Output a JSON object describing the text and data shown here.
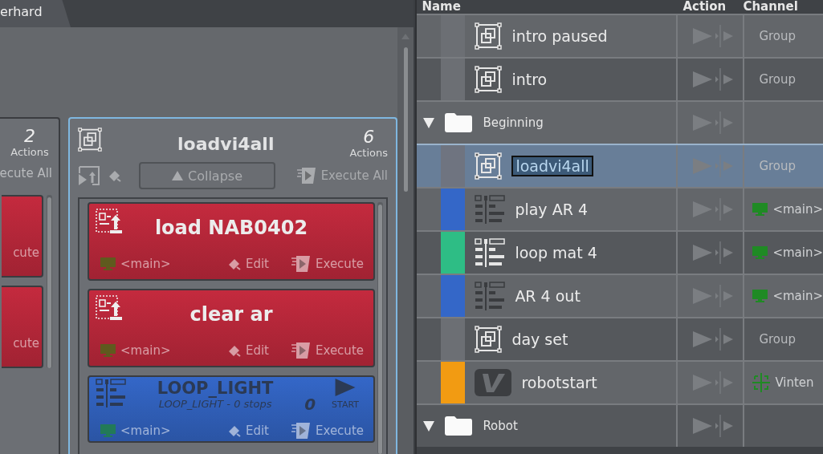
{
  "tab": {
    "label": "erhard"
  },
  "left_group": {
    "count": "2",
    "count_label": "Actions",
    "execute_all": "ecute All",
    "actions": [
      {
        "execute": "cute",
        "color": "#c42a3e"
      },
      {
        "execute": "cute",
        "color": "#c42a3e"
      }
    ]
  },
  "group": {
    "title": "loadvi4all",
    "count": "6",
    "count_label": "Actions",
    "collapse": "Collapse",
    "execute_all": "Execute All",
    "selected": true,
    "actions": [
      {
        "kind": "load",
        "title": "load NAB0402",
        "channel": "<main>",
        "edit": "Edit",
        "execute": "Execute",
        "color": "#c42a3e"
      },
      {
        "kind": "load",
        "title": "clear ar",
        "channel": "<main>",
        "edit": "Edit",
        "execute": "Execute",
        "color": "#c42a3e"
      },
      {
        "kind": "playlist",
        "title": "LOOP_LIGHT",
        "subtitle": "LOOP_LIGHT - 0 stops",
        "counter": "0",
        "start": "START",
        "channel": "<main>",
        "edit": "Edit",
        "execute": "Execute",
        "color": "#3467c8"
      }
    ]
  },
  "table": {
    "columns": [
      "Name",
      "Action",
      "Channel"
    ],
    "rows": [
      {
        "kind": "group",
        "name": "intro paused",
        "color": "#6c6f74",
        "selected": false,
        "channel": {
          "kind": "text",
          "label": "Group"
        }
      },
      {
        "kind": "group",
        "name": "intro",
        "color": "#6c6f74",
        "selected": false,
        "channel": {
          "kind": "text",
          "label": "Group"
        }
      },
      {
        "kind": "folder",
        "name": "Beginning",
        "expanded": true,
        "selected": false
      },
      {
        "kind": "group",
        "name": "loadvi4all",
        "color": "#6f7480",
        "selected": true,
        "channel": {
          "kind": "text",
          "label": "Group"
        }
      },
      {
        "kind": "playlist",
        "name": "play AR 4",
        "color": "#3467c8",
        "selected": false,
        "channel": {
          "kind": "screen",
          "label": "<main>"
        }
      },
      {
        "kind": "playlist",
        "name": "loop mat 4",
        "color": "#2ebd85",
        "selected": false,
        "channel": {
          "kind": "screen",
          "label": "<main>"
        }
      },
      {
        "kind": "playlist",
        "name": "AR 4 out",
        "color": "#3467c8",
        "selected": false,
        "channel": {
          "kind": "screen",
          "label": "<main>"
        }
      },
      {
        "kind": "group",
        "name": "day set",
        "color": "#6c6f74",
        "selected": false,
        "channel": {
          "kind": "text",
          "label": "Group"
        }
      },
      {
        "kind": "robot",
        "name": "robotstart",
        "color": "#f29b12",
        "selected": false,
        "channel": {
          "kind": "vinten",
          "label": "Vinten"
        }
      },
      {
        "kind": "folder",
        "name": "Robot",
        "expanded": true,
        "selected": false
      }
    ]
  }
}
